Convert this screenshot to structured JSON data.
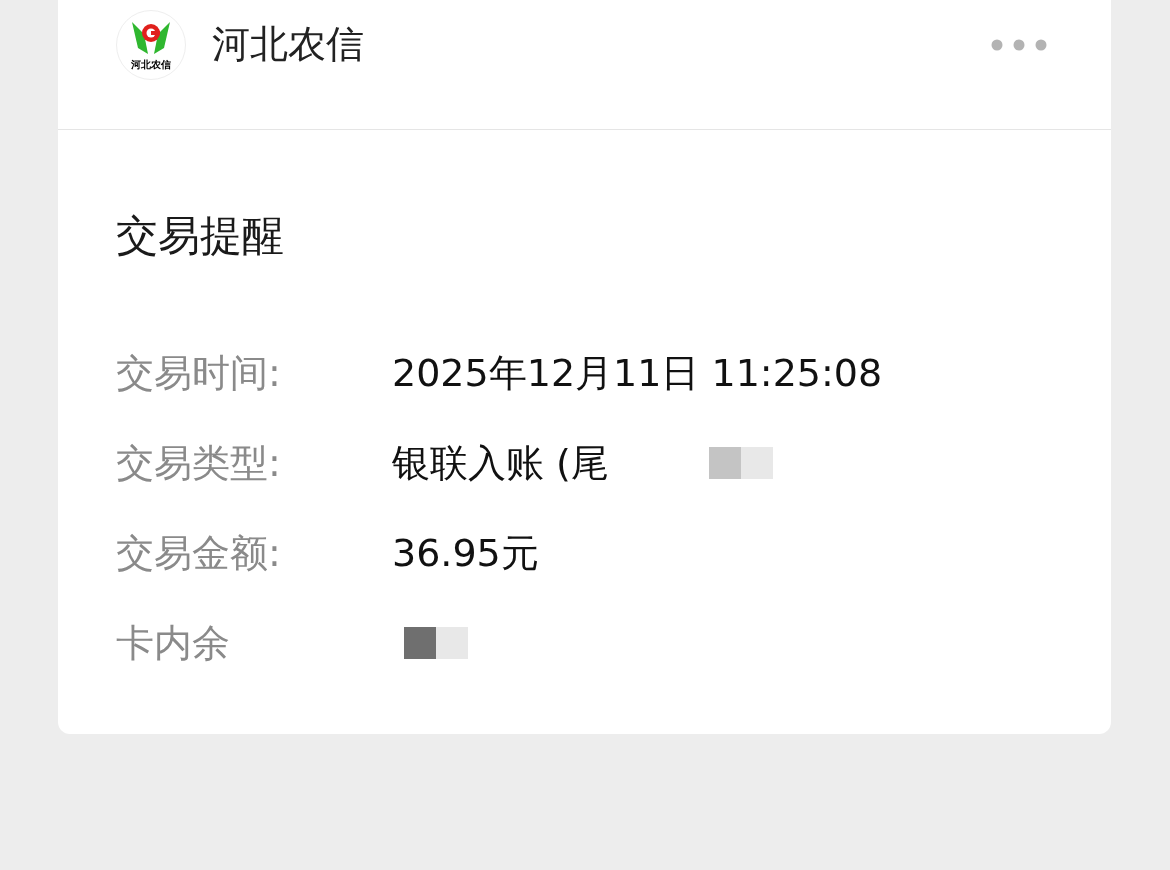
{
  "account": {
    "name": "河北农信",
    "logo_text": "河北农信"
  },
  "message": {
    "title": "交易提醒",
    "rows": [
      {
        "label": "交易时间:",
        "value": "2025年12月11日 11:25:08",
        "redacted": false
      },
      {
        "label": "交易类型:",
        "value": "银联入账 (尾",
        "redacted": true
      },
      {
        "label": "交易金额:",
        "value": "36.95元",
        "redacted": false
      },
      {
        "label": "卡内余",
        "value": "",
        "redacted": true
      }
    ]
  }
}
